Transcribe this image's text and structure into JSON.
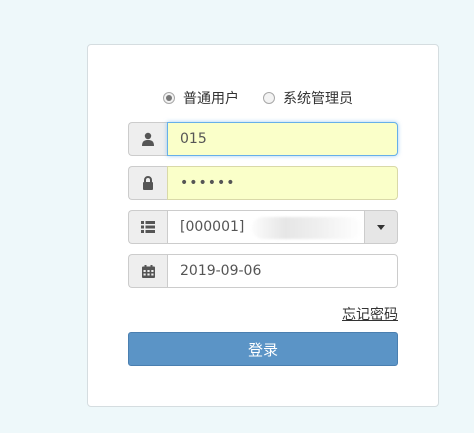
{
  "colors": {
    "page_background": "#eef8fa",
    "autofill_yellow": "#faffc9",
    "login_button": "#5b94c6"
  },
  "roles": [
    {
      "label": "普通用户",
      "checked": true
    },
    {
      "label": "系统管理员",
      "checked": false
    }
  ],
  "username": {
    "value": "015",
    "icon": "user-icon"
  },
  "password": {
    "value": "••••••",
    "icon": "lock-icon"
  },
  "org_select": {
    "value": "[000001]",
    "icon": "list-icon"
  },
  "date": {
    "value": "2019-09-06",
    "icon": "calendar-icon"
  },
  "forgot_password": "忘记密码",
  "login_label": "登录"
}
